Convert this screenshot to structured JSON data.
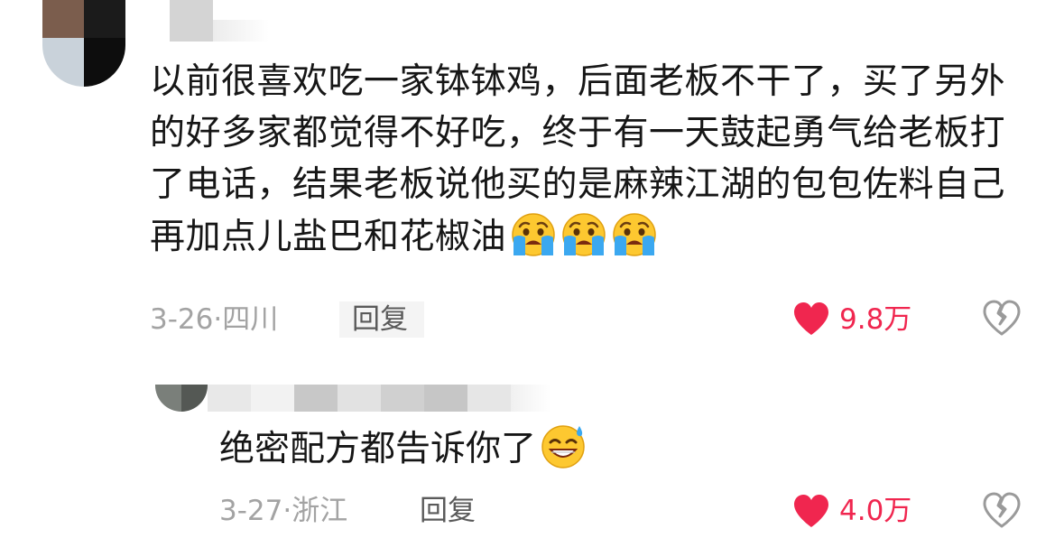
{
  "comments": [
    {
      "text": "以前很喜欢吃一家钵钵鸡，后面老板不干了，买了另外的好多家都觉得不好吃，终于有一天鼓起勇气给老板打了电话，结果老板说他买的是麻辣江湖的包包佐料自己再加点儿盐巴和花椒油",
      "emojis": [
        "crying-face",
        "crying-face",
        "crying-face"
      ],
      "date": "3-26",
      "location": "四川",
      "reply_label": "回复",
      "likes": "9.8万"
    },
    {
      "text": "绝密配方都告诉你了",
      "emojis": [
        "grinning-sweat-face"
      ],
      "date": "3-27",
      "location": "浙江",
      "reply_label": "回复",
      "likes": "4.0万"
    }
  ],
  "colors": {
    "like_red": "#f0264f",
    "meta_gray": "#a3a3a3",
    "text": "#161616"
  }
}
